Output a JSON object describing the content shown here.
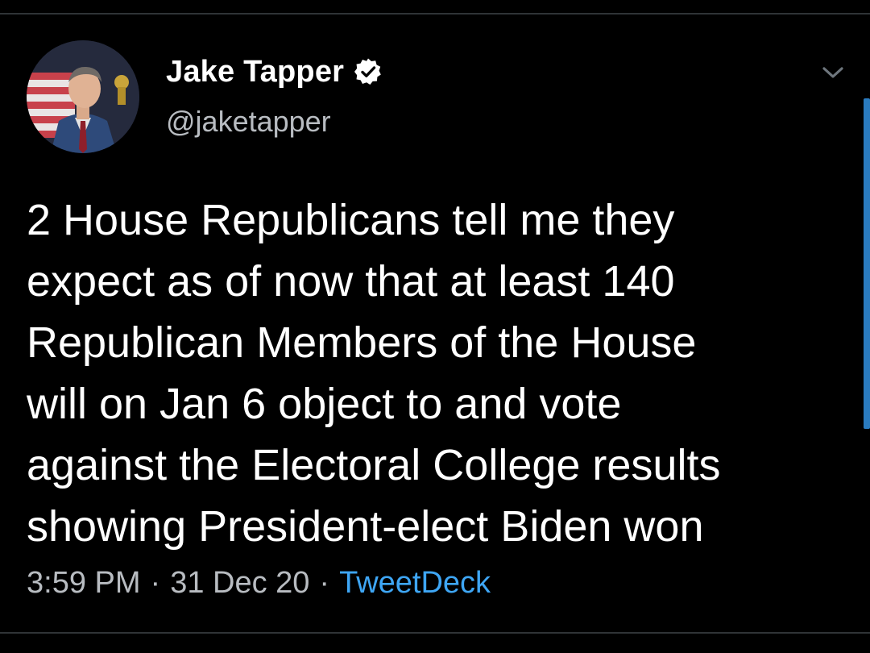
{
  "tweet": {
    "author": {
      "display_name": "Jake Tapper",
      "handle": "@jaketapper",
      "verified_icon": "verified-badge-icon",
      "avatar": "profile-photo"
    },
    "menu_icon": "chevron-down-icon",
    "text": "2 House Republicans tell me they\nexpect as of now that at least 140\nRepublican Members of the House\nwill on Jan 6 object to and vote\nagainst the Electoral College results\nshowing President-elect Biden won",
    "time": "3:59 PM",
    "separator": "·",
    "date": "31 Dec 20",
    "source": "TweetDeck"
  },
  "colors": {
    "background": "#000000",
    "text": "#ffffff",
    "secondary_text": "#b8bcc1",
    "link": "#3ea6f5",
    "divider": "#2f3336",
    "scrollbar": "#2a7bbf"
  }
}
